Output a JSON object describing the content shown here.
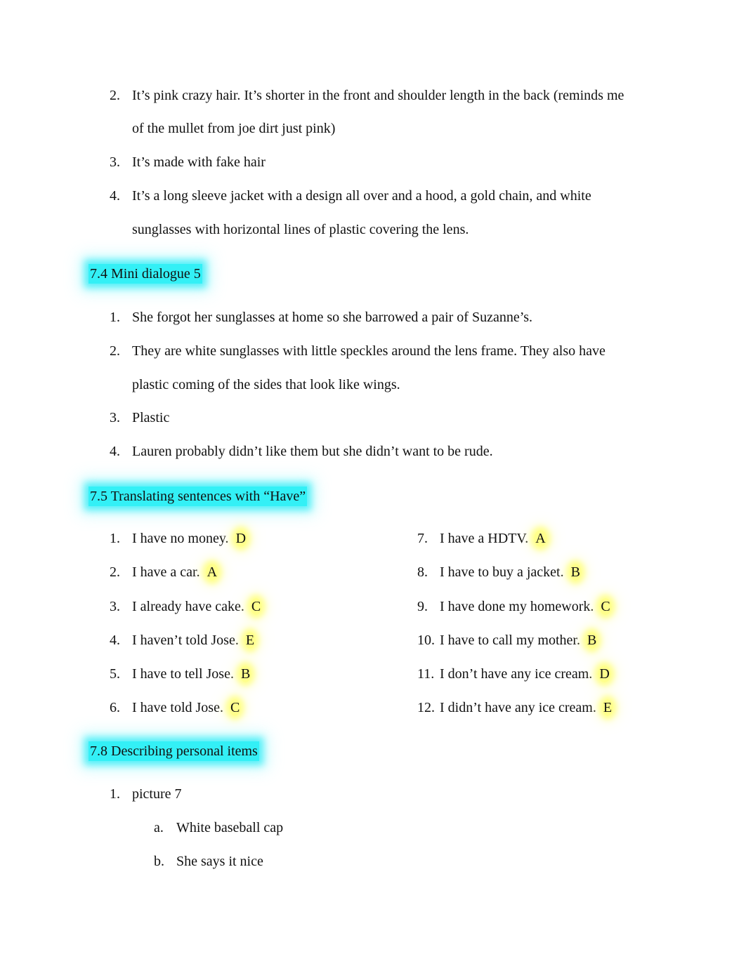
{
  "section_prev": {
    "items": [
      {
        "number": "2.",
        "lines": [
          "It’s pink crazy hair. It’s shorter in the front and shoulder length in the back (reminds me",
          "of the mullet from joe dirt just pink)"
        ]
      },
      {
        "number": "3.",
        "lines": [
          "It’s made with fake hair"
        ]
      },
      {
        "number": "4.",
        "lines": [
          "It’s a long sleeve jacket with a design all over and a hood, a gold chain, and white",
          "sunglasses with horizontal lines of plastic covering the lens."
        ]
      }
    ]
  },
  "section_7_4": {
    "title": "7.4 Mini dialogue 5",
    "items": [
      {
        "number": "1.",
        "lines": [
          "She forgot her sunglasses at home so she barrowed a pair of Suzanne’s."
        ]
      },
      {
        "number": "2.",
        "lines": [
          "They are white sunglasses with little speckles around the lens frame. They also have",
          "plastic coming of the sides that look like wings."
        ]
      },
      {
        "number": "3.",
        "lines": [
          "Plastic"
        ]
      },
      {
        "number": "4.",
        "lines": [
          "Lauren probably didn’t like them but she didn’t want to be rude."
        ]
      }
    ]
  },
  "section_7_5": {
    "title": "7.5 Translating sentences with “Have”",
    "left_column": [
      {
        "number": "1.",
        "text": "I have no money.",
        "answer": "D"
      },
      {
        "number": "2.",
        "text": "I have a car.",
        "answer": "A"
      },
      {
        "number": "3.",
        "text": "I already have cake.",
        "answer": "C"
      },
      {
        "number": "4.",
        "text": "I haven’t told Jose.",
        "answer": "E"
      },
      {
        "number": "5.",
        "text": "I have to tell Jose.",
        "answer": "B"
      },
      {
        "number": "6.",
        "text": "I have told Jose.",
        "answer": "C"
      }
    ],
    "right_column": [
      {
        "number": "7.",
        "text": "I have a HDTV.",
        "answer": "A"
      },
      {
        "number": "8.",
        "text": "I have to buy a jacket.",
        "answer": "B"
      },
      {
        "number": "9.",
        "text": "I have done my homework.",
        "answer": "C"
      },
      {
        "number": "10.",
        "text": "I have to call my mother.",
        "answer": "B"
      },
      {
        "number": "11.",
        "text": "I don’t have any ice cream.",
        "answer": "D"
      },
      {
        "number": "12.",
        "text": "I didn’t have any ice cream.",
        "answer": "E"
      }
    ]
  },
  "section_7_8": {
    "title": "7.8 Describing personal items",
    "items": [
      {
        "number": "1.",
        "text": "picture 7",
        "subitems": [
          {
            "letter": "a.",
            "text": "White baseball cap"
          },
          {
            "letter": "b.",
            "text": "She says it nice"
          }
        ]
      }
    ]
  },
  "colors": {
    "heading_highlight": "#33f0f6",
    "answer_highlight": "#ffff78",
    "text": "#111111"
  }
}
